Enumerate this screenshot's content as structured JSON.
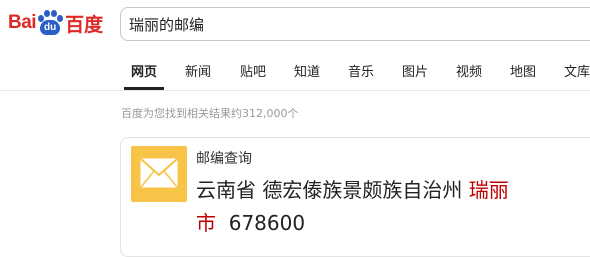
{
  "logo": {
    "text_bai": "Bai",
    "text_du": "du",
    "text_cn": "百度"
  },
  "search": {
    "query": "瑞丽的邮编"
  },
  "tabs": [
    {
      "label": "网页",
      "active": true
    },
    {
      "label": "新闻",
      "active": false
    },
    {
      "label": "贴吧",
      "active": false
    },
    {
      "label": "知道",
      "active": false
    },
    {
      "label": "音乐",
      "active": false
    },
    {
      "label": "图片",
      "active": false
    },
    {
      "label": "视频",
      "active": false
    },
    {
      "label": "地图",
      "active": false
    },
    {
      "label": "文库",
      "active": false
    }
  ],
  "results": {
    "count_text": "百度为您找到相关结果约312,000个"
  },
  "answer_card": {
    "icon": "mail-envelope-icon",
    "title": "邮编查询",
    "region": "云南省 德宏傣族景颇族自治州 ",
    "city": "瑞丽市",
    "postcode": "678600"
  },
  "colors": {
    "brand_red": "#de2a25",
    "brand_blue": "#2a5fc9",
    "highlight_red": "#c00000",
    "mail_tile": "#f8c447"
  }
}
